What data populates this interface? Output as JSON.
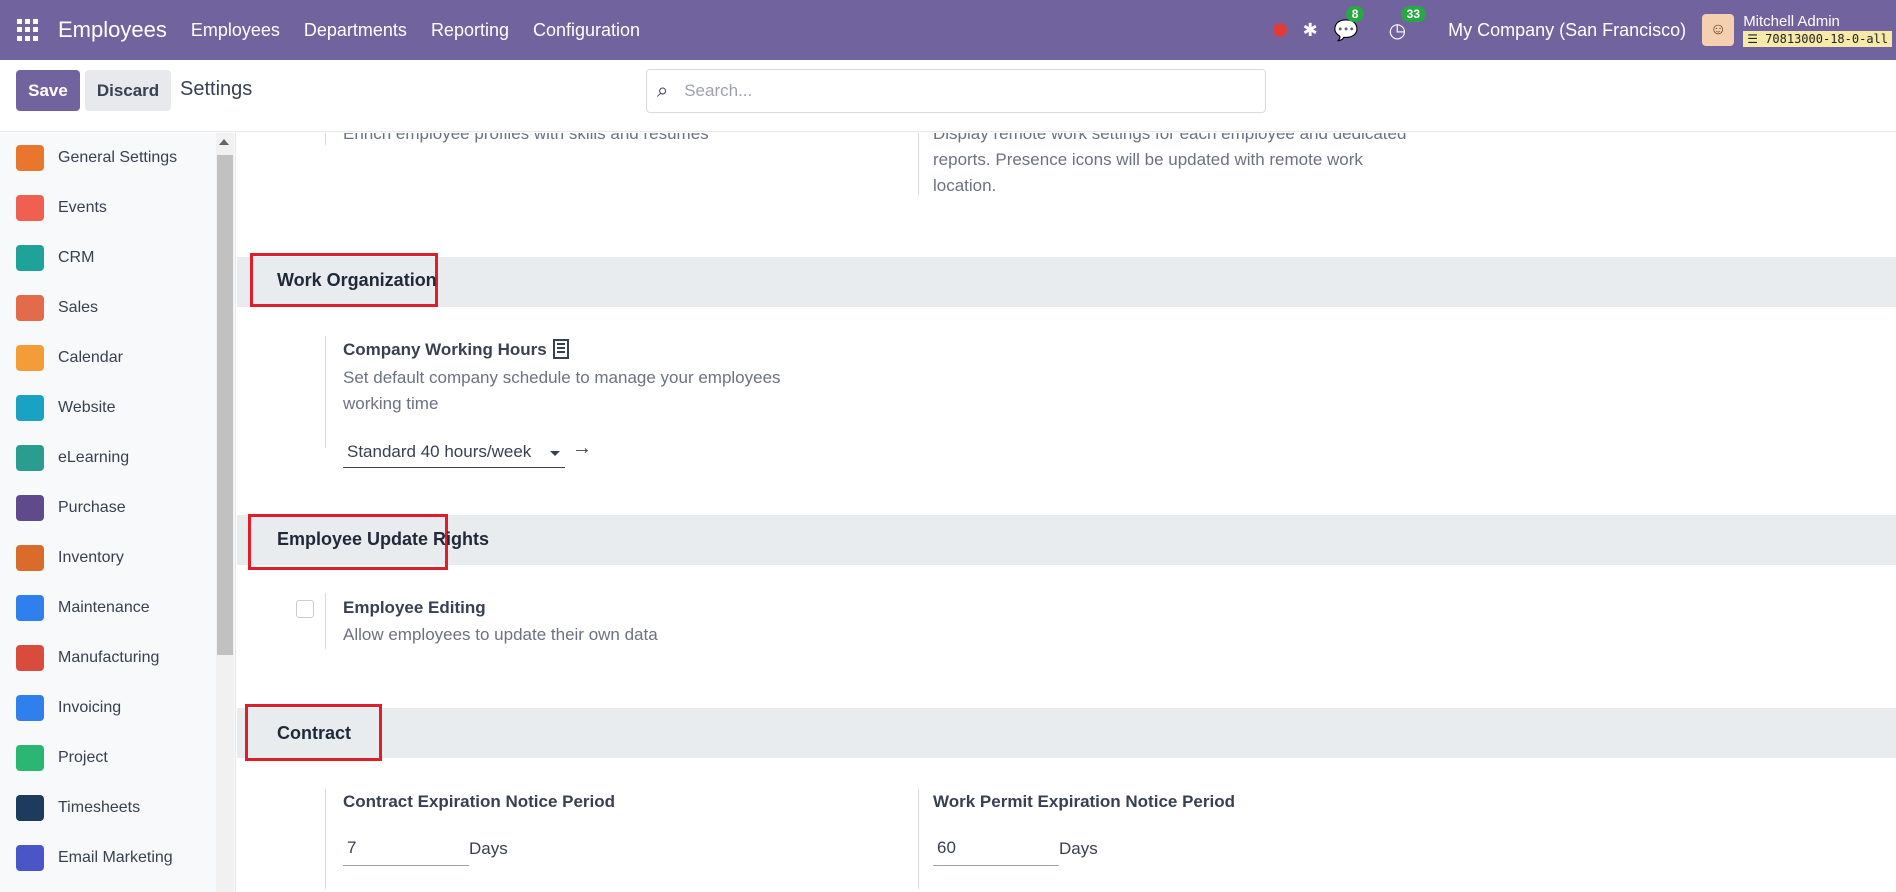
{
  "navbar": {
    "brand": "Employees",
    "menu": [
      "Employees",
      "Departments",
      "Reporting",
      "Configuration"
    ],
    "chat_count": "8",
    "activity_count": "33",
    "company": "My Company (San Francisco)",
    "user_name": "Mitchell Admin",
    "db_name": "70813000-18-0-all"
  },
  "control": {
    "save_label": "Save",
    "discard_label": "Discard",
    "title": "Settings",
    "search_placeholder": "Search..."
  },
  "sidebar": {
    "items": [
      {
        "label": "General Settings",
        "icon": "general-settings-icon",
        "color": "#e8762d"
      },
      {
        "label": "Events",
        "icon": "events-icon",
        "color": "#f06050"
      },
      {
        "label": "CRM",
        "icon": "crm-icon",
        "color": "#1fa29a"
      },
      {
        "label": "Sales",
        "icon": "sales-icon",
        "color": "#e36a4a"
      },
      {
        "label": "Calendar",
        "icon": "calendar-icon",
        "color": "#f29d38"
      },
      {
        "label": "Website",
        "icon": "website-icon",
        "color": "#1aa2c4"
      },
      {
        "label": "eLearning",
        "icon": "elearning-icon",
        "color": "#2a9d8f"
      },
      {
        "label": "Purchase",
        "icon": "purchase-icon",
        "color": "#5f4b8b"
      },
      {
        "label": "Inventory",
        "icon": "inventory-icon",
        "color": "#d96b2b"
      },
      {
        "label": "Maintenance",
        "icon": "maintenance-icon",
        "color": "#2f80ed"
      },
      {
        "label": "Manufacturing",
        "icon": "manufacturing-icon",
        "color": "#d94c3d"
      },
      {
        "label": "Invoicing",
        "icon": "invoicing-icon",
        "color": "#2f80ed"
      },
      {
        "label": "Project",
        "icon": "project-icon",
        "color": "#2bb673"
      },
      {
        "label": "Timesheets",
        "icon": "timesheets-icon",
        "color": "#1e3a5f"
      },
      {
        "label": "Email Marketing",
        "icon": "email-marketing-icon",
        "color": "#4a55c8"
      }
    ]
  },
  "content": {
    "top_left_partial": "Enrich employee profiles with skills and resumes",
    "top_right_partial_1": "Display remote work settings for each employee and dedicated",
    "top_right_partial_2": "reports. Presence icons will be updated with remote work",
    "top_right_partial_3": "location.",
    "work_org": {
      "section_title": "Work Organization",
      "setting_title": "Company Working Hours",
      "desc_1": "Set default company schedule to manage your employees",
      "desc_2": "working time",
      "select_value": "Standard 40 hours/week"
    },
    "update_rights": {
      "section_title": "Employee Update Rights",
      "setting_title": "Employee Editing",
      "desc": "Allow employees to update their own data",
      "checked": false
    },
    "contract": {
      "section_title": "Contract",
      "left_title": "Contract Expiration Notice Period",
      "left_value": "7",
      "left_unit": "Days",
      "right_title": "Work Permit Expiration Notice Period",
      "right_value": "60",
      "right_unit": "Days"
    }
  }
}
